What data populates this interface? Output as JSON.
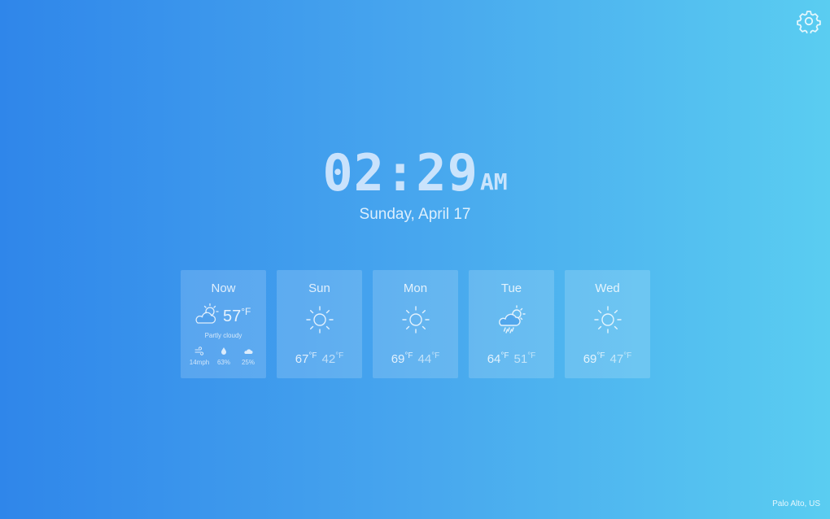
{
  "header": {
    "settings_icon": "gear-icon"
  },
  "clock": {
    "time": "02:29",
    "ampm": "AM",
    "date": "Sunday, April 17"
  },
  "current": {
    "label": "Now",
    "icon": "partly-cloudy-icon",
    "temp": "57",
    "unit": "°F",
    "condition": "Partly cloudy",
    "stats": [
      {
        "icon": "wind-icon",
        "value": "14mph"
      },
      {
        "icon": "humidity-icon",
        "value": "63%"
      },
      {
        "icon": "cloud-cover-icon",
        "value": "25%"
      }
    ]
  },
  "forecast": [
    {
      "day": "Sun",
      "icon": "sun-icon",
      "high": "67",
      "low": "42",
      "unit": "°F"
    },
    {
      "day": "Mon",
      "icon": "sun-icon",
      "high": "69",
      "low": "44",
      "unit": "°F"
    },
    {
      "day": "Tue",
      "icon": "rain-sun-icon",
      "high": "64",
      "low": "51",
      "unit": "°F"
    },
    {
      "day": "Wed",
      "icon": "sun-icon",
      "high": "69",
      "low": "47",
      "unit": "°F"
    }
  ],
  "footer": {
    "location": "Palo Alto, US"
  }
}
